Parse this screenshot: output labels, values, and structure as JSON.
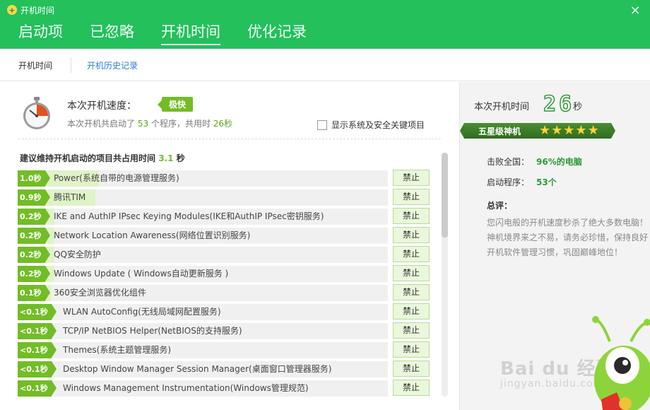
{
  "app": {
    "title": "开机时间",
    "logo": "+"
  },
  "header": {
    "tabs": [
      {
        "label": "启动项"
      },
      {
        "label": "已忽略"
      },
      {
        "label": "开机时间"
      },
      {
        "label": "优化记录"
      }
    ],
    "active_tab": 2,
    "close_icon": "×"
  },
  "subnav": {
    "tabs": [
      "开机时间",
      "开机历史记录"
    ]
  },
  "speed": {
    "label": "本次开机速度：",
    "badge": "极快",
    "summary_pre": "本次开机共启动了",
    "program_count": "53",
    "summary_mid": "个程序，共用时",
    "seconds": "26秒",
    "show_system_label": "显示系统及安全关键项目"
  },
  "suggest": {
    "pre": "建议维持开机启动的项目共占用时间",
    "value": "3.1",
    "unit": "秒"
  },
  "rows": [
    {
      "time": "1.0秒",
      "name": "Power(系统自带的电源管理服务)",
      "fill": 0.22,
      "action": "禁止"
    },
    {
      "time": "0.9秒",
      "name": "腾讯TIM",
      "fill": 0.21,
      "action": "禁止"
    },
    {
      "time": "0.2秒",
      "name": "IKE and AuthIP IPsec Keying Modules(IKE和AuthIP IPsec密钥服务)",
      "fill": 0.1,
      "action": "禁止"
    },
    {
      "time": "0.2秒",
      "name": "Network Location Awareness(网络位置识别服务)",
      "fill": 0.1,
      "action": "禁止"
    },
    {
      "time": "0.2秒",
      "name": "QQ安全防护",
      "fill": 0.1,
      "action": "禁止"
    },
    {
      "time": "0.2秒",
      "name": "Windows Update ( Windows自动更新服务 )",
      "fill": 0.1,
      "action": "禁止"
    },
    {
      "time": "0.1秒",
      "name": "360安全浏览器优化组件",
      "fill": 0.09,
      "action": "禁止"
    },
    {
      "time": "<0.1秒",
      "name": "WLAN AutoConfig(无线局域网配置服务)",
      "fill": 0,
      "action": "禁止"
    },
    {
      "time": "<0.1秒",
      "name": "TCP/IP NetBIOS Helper(NetBIOS的支持服务)",
      "fill": 0,
      "action": "禁止"
    },
    {
      "time": "<0.1秒",
      "name": "Themes(系统主题管理服务)",
      "fill": 0,
      "action": "禁止"
    },
    {
      "time": "<0.1秒",
      "name": "Desktop Window Manager Session Manager(桌面窗口管理器服务)",
      "fill": 0,
      "action": "禁止"
    },
    {
      "time": "<0.1秒",
      "name": "Windows Management Instrumentation(Windows管理规范)",
      "fill": 0,
      "action": "禁止"
    }
  ],
  "right": {
    "boot_time_label": "本次开机时间",
    "boot_time_value": "26",
    "boot_time_unit": "秒",
    "rank_title": "五星级神机",
    "stars": 5,
    "beat_label": "击败全国：",
    "beat_value": "96%的电脑",
    "programs_label": "启动程序：",
    "programs_value": "53个",
    "comment_title": "总评：",
    "comment": "您闪电般的开机速度秒杀了绝大多数电脑！神机境界来之不易，请务必珍惜，保持良好开机软件管理习惯，巩固巅峰地位！"
  },
  "watermark": {
    "brand": "Bai du 经验",
    "url": "jingyan.baidu.com"
  },
  "colors": {
    "brand_green": "#23c05c",
    "accent_green": "#72bd26",
    "link_blue": "#2b7fd1"
  }
}
